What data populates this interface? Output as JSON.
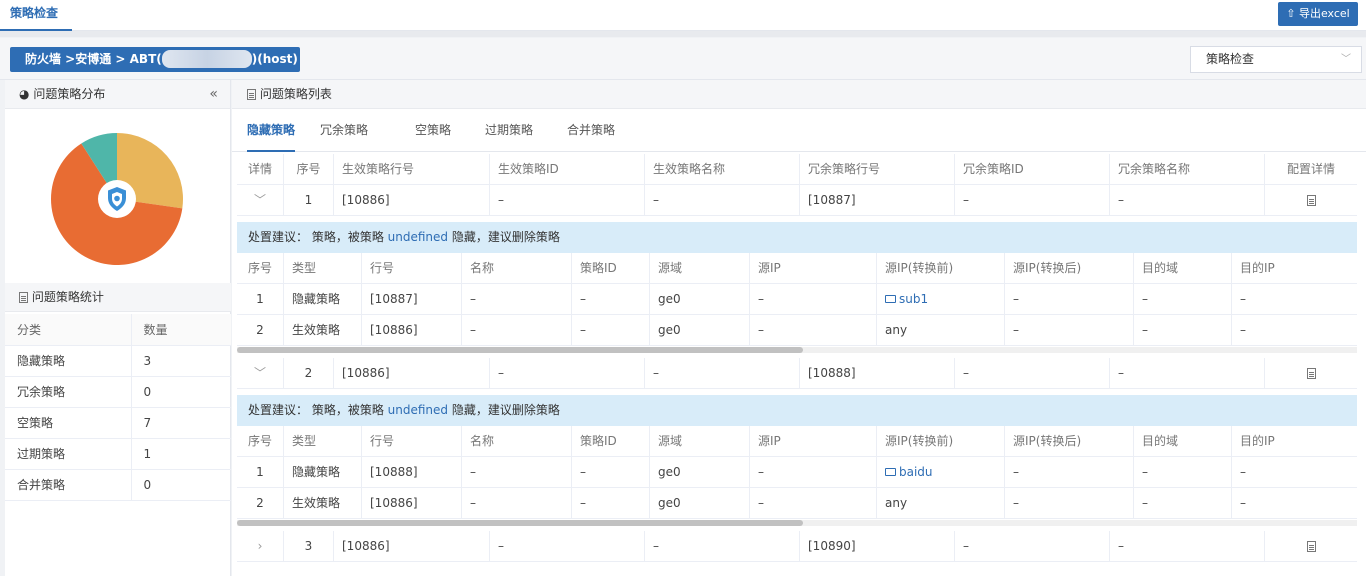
{
  "top": {
    "tab": "策略检查",
    "export": "⇧ 导出excel"
  },
  "breadcrumb": {
    "prefix": "防火墙 >安博通 > ABT(",
    "suffix": ")(host)"
  },
  "select": {
    "value": "策略检查"
  },
  "left": {
    "dist_title": "问题策略分布",
    "stat_title": "问题策略统计",
    "headers": [
      "分类",
      "数量"
    ],
    "rows": [
      [
        "隐藏策略",
        "3"
      ],
      [
        "冗余策略",
        "0"
      ],
      [
        "空策略",
        "7"
      ],
      [
        "过期策略",
        "1"
      ],
      [
        "合并策略",
        "0"
      ]
    ],
    "pie": [
      {
        "name": "隐藏策略",
        "value": 3,
        "color": "#e8b55a"
      },
      {
        "name": "空策略",
        "value": 7,
        "color": "#e86c33"
      },
      {
        "name": "过期策略",
        "value": 1,
        "color": "#4fb6a9"
      }
    ]
  },
  "right": {
    "title": "问题策略列表",
    "tabs": [
      "隐藏策略",
      "冗余策略",
      "空策略",
      "过期策略",
      "合并策略"
    ],
    "main_headers": [
      "详情",
      "序号",
      "生效策略行号",
      "生效策略ID",
      "生效策略名称",
      "冗余策略行号",
      "冗余策略ID",
      "冗余策略名称",
      "配置详情"
    ],
    "sub_headers": [
      "序号",
      "类型",
      "行号",
      "名称",
      "策略ID",
      "源域",
      "源IP",
      "源IP(转换前)",
      "源IP(转换后)",
      "目的域",
      "目的IP"
    ],
    "advice_prefix": "处置建议：  策略，被策略 ",
    "advice_link": "undefined",
    "advice_suffix": " 隐藏，建议删除策略",
    "groups": [
      {
        "toggle": "﹀",
        "seq": "1",
        "line": "[10886]",
        "id": "–",
        "name": "–",
        "rline": "[10887]",
        "rid": "–",
        "rname": "–",
        "sub": [
          [
            "1",
            "隐藏策略",
            "[10887]",
            "–",
            "–",
            "ge0",
            "–",
            "sub1",
            "–",
            "–",
            "–"
          ],
          [
            "2",
            "生效策略",
            "[10886]",
            "–",
            "–",
            "ge0",
            "–",
            "any",
            "–",
            "–",
            "–"
          ]
        ]
      },
      {
        "toggle": "﹀",
        "seq": "2",
        "line": "[10886]",
        "id": "–",
        "name": "–",
        "rline": "[10888]",
        "rid": "–",
        "rname": "–",
        "sub": [
          [
            "1",
            "隐藏策略",
            "[10888]",
            "–",
            "–",
            "ge0",
            "–",
            "baidu",
            "–",
            "–",
            "–"
          ],
          [
            "2",
            "生效策略",
            "[10886]",
            "–",
            "–",
            "ge0",
            "–",
            "any",
            "–",
            "–",
            "–"
          ]
        ]
      },
      {
        "toggle": "›",
        "seq": "3",
        "line": "[10886]",
        "id": "–",
        "name": "–",
        "rline": "[10890]",
        "rid": "–",
        "rname": "–",
        "sub": []
      }
    ]
  }
}
